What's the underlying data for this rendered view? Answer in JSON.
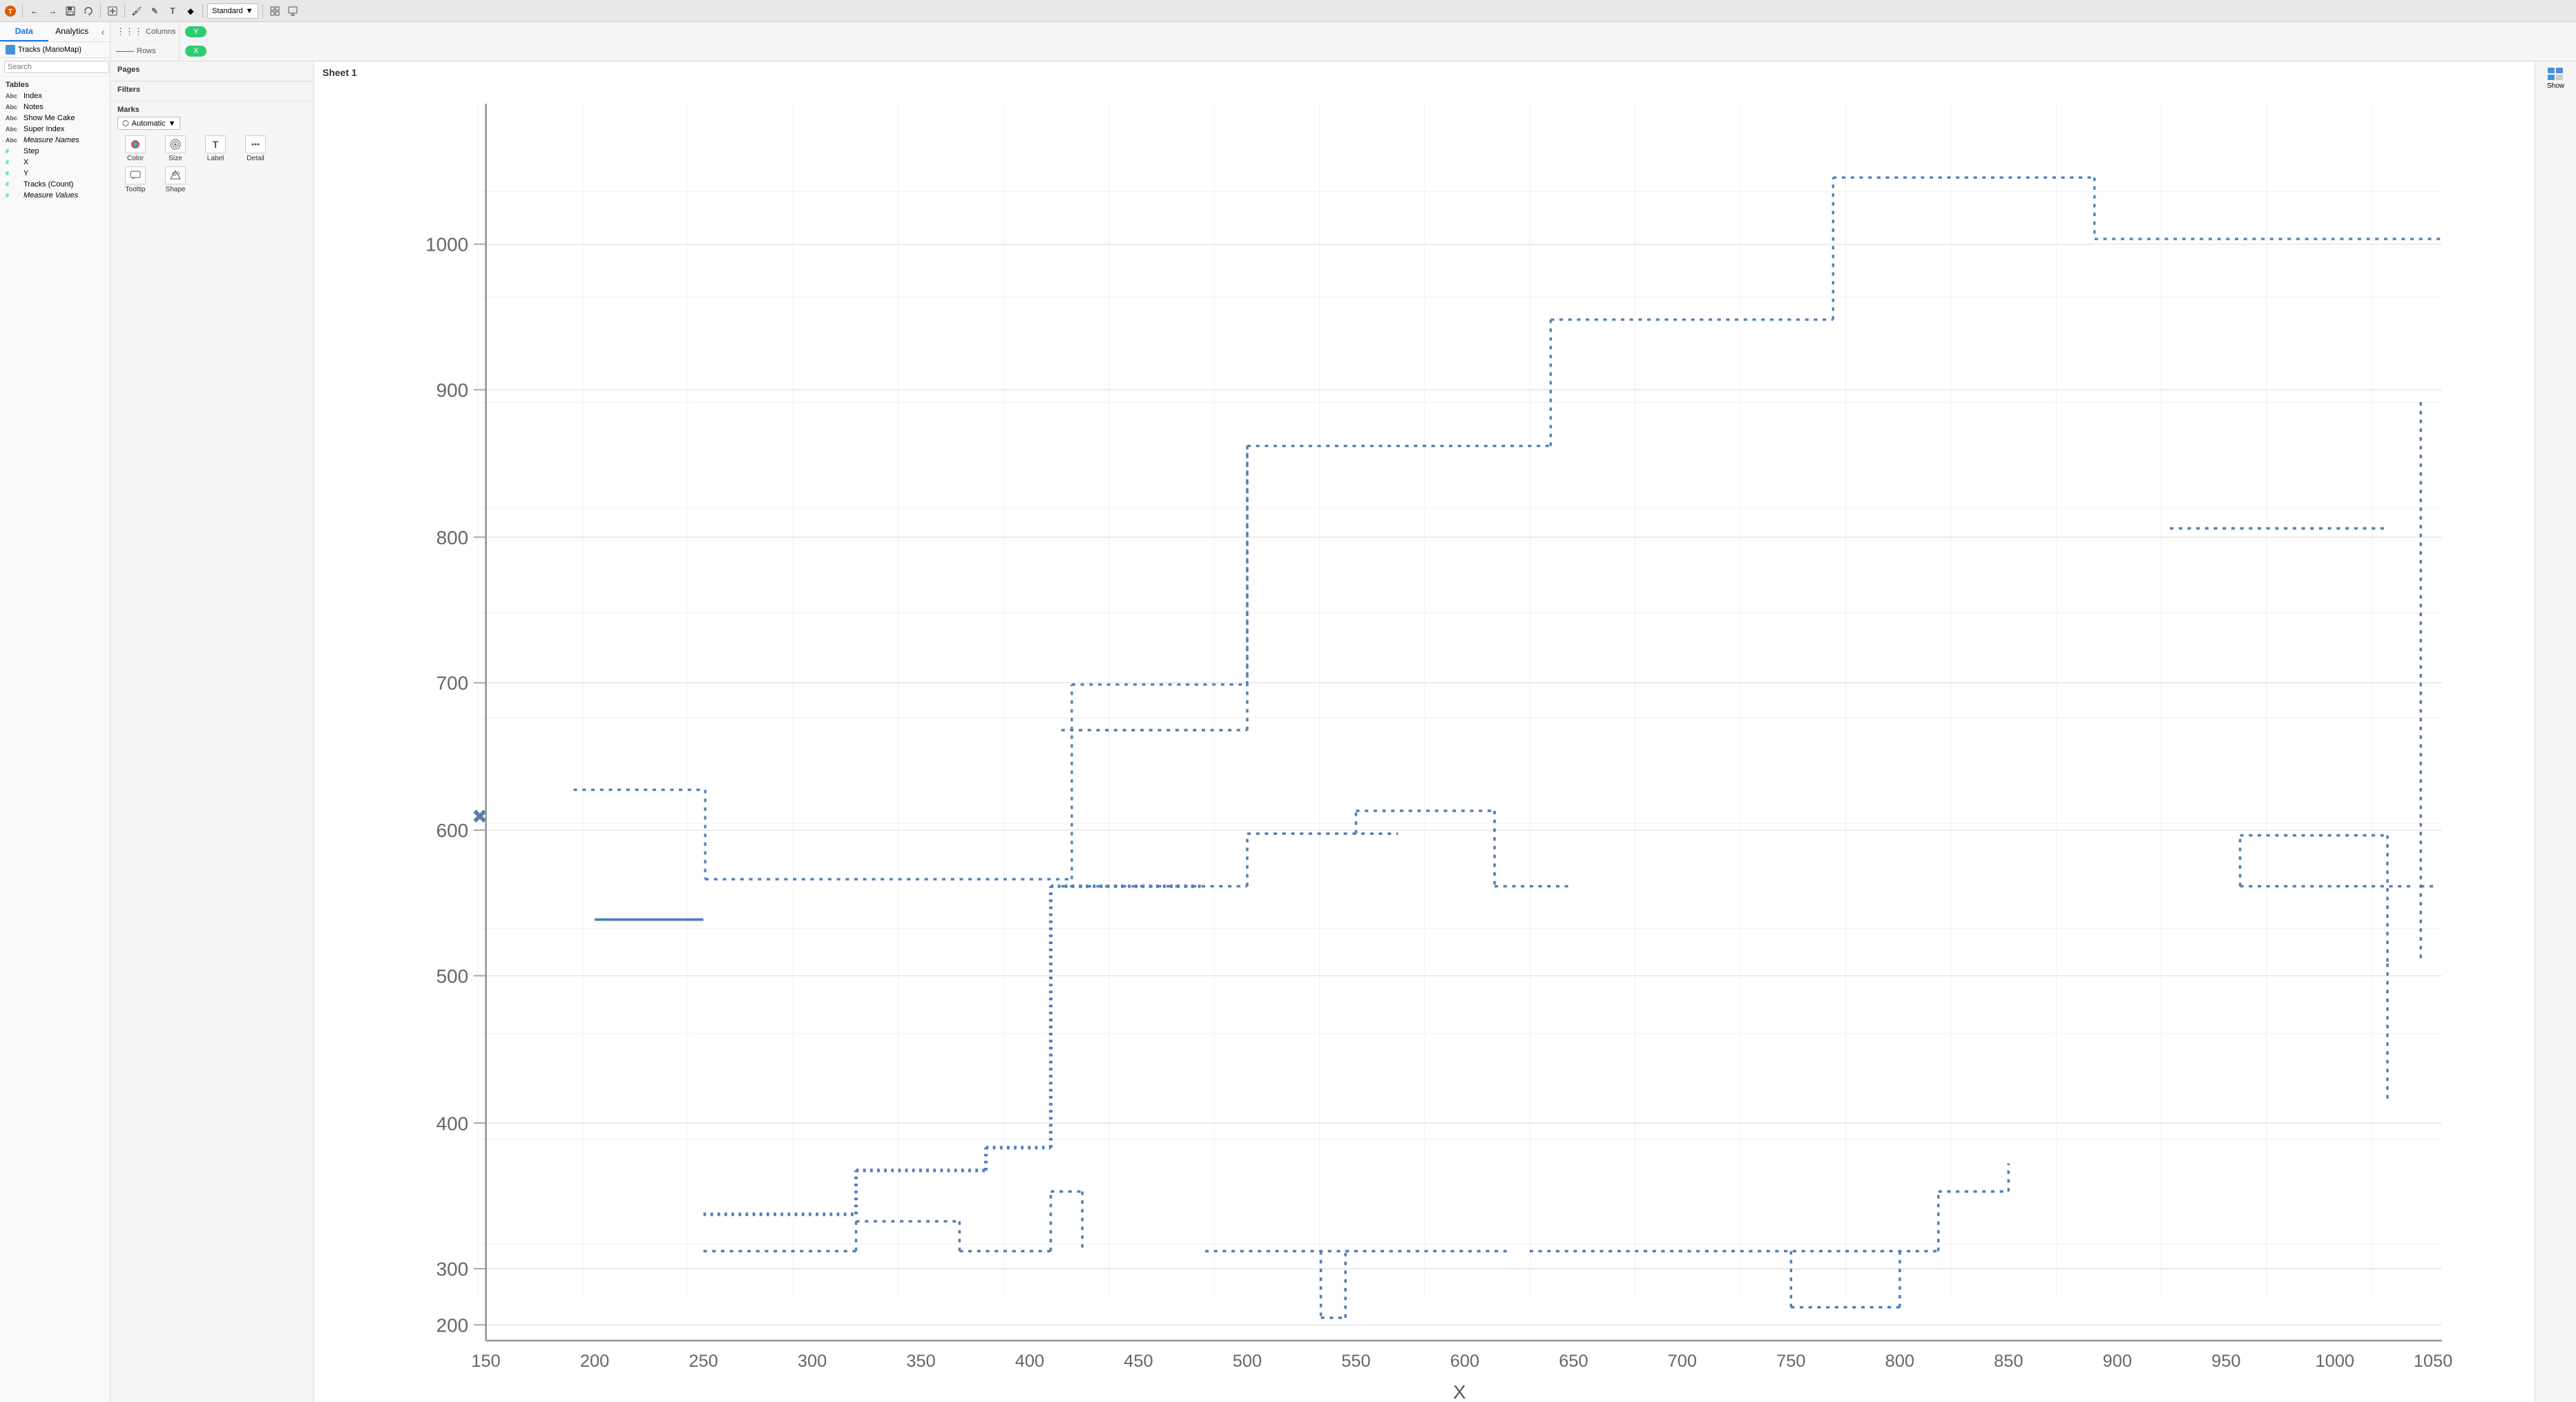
{
  "toolbar": {
    "undo_label": "←",
    "redo_label": "→",
    "dropdown_standard": "Standard",
    "show_label": "Show"
  },
  "left_panel": {
    "tab_data": "Data",
    "tab_analytics": "Analytics",
    "data_source": "Tracks (MarioMap)",
    "search_placeholder": "Search",
    "tables_label": "Tables",
    "items": [
      {
        "type": "Abc",
        "name": "Index",
        "italic": false,
        "green": false
      },
      {
        "type": "Abc",
        "name": "Notes",
        "italic": false,
        "green": false
      },
      {
        "type": "Abc",
        "name": "Show Me Cake",
        "italic": false,
        "green": false
      },
      {
        "type": "Abc",
        "name": "Super Index",
        "italic": false,
        "green": false
      },
      {
        "type": "Abc",
        "name": "Measure Names",
        "italic": true,
        "green": false
      },
      {
        "type": "#",
        "name": "Step",
        "italic": false,
        "green": true
      },
      {
        "type": "#",
        "name": "X",
        "italic": false,
        "green": true
      },
      {
        "type": "#",
        "name": "Y",
        "italic": false,
        "green": true
      },
      {
        "type": "#",
        "name": "Tracks (Count)",
        "italic": false,
        "green": true
      },
      {
        "type": "#",
        "name": "Measure Values",
        "italic": true,
        "green": true
      }
    ]
  },
  "shelf": {
    "columns_label": "Columns",
    "columns_icon": "|||",
    "rows_label": "Rows",
    "rows_icon": "—",
    "columns_pill": "Y",
    "rows_pill": "X"
  },
  "pages_section": {
    "label": "Pages"
  },
  "filters_section": {
    "label": "Filters"
  },
  "marks_section": {
    "label": "Marks",
    "type": "Automatic",
    "buttons": [
      {
        "id": "color",
        "label": "Color",
        "icon": "●"
      },
      {
        "id": "size",
        "label": "Size",
        "icon": "◎"
      },
      {
        "id": "label",
        "label": "Label",
        "icon": "T"
      },
      {
        "id": "detail",
        "label": "Detail",
        "icon": "⋯"
      },
      {
        "id": "tooltip",
        "label": "Tooltip",
        "icon": "💬"
      },
      {
        "id": "shape",
        "label": "Shape",
        "icon": "⬡"
      }
    ]
  },
  "chart": {
    "title": "Sheet 1",
    "x_axis_label": "X",
    "y_axis_label": "",
    "x_ticks": [
      150,
      200,
      250,
      300,
      350,
      400,
      450,
      500,
      550,
      600,
      650,
      700,
      750,
      800,
      850,
      900,
      950,
      1000,
      1050
    ],
    "y_ticks": [
      200,
      300,
      400,
      500,
      600,
      700,
      800,
      900,
      1000
    ]
  }
}
